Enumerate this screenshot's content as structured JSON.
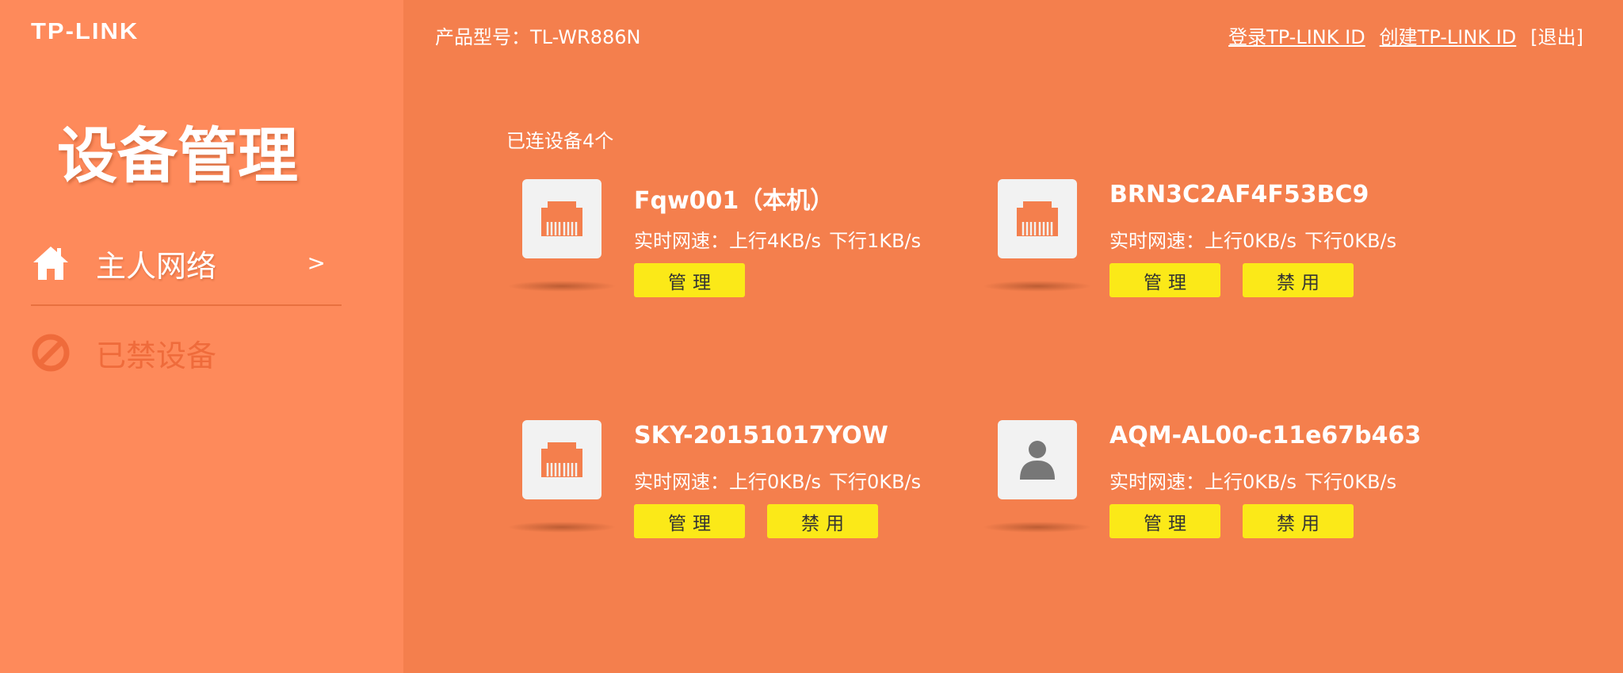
{
  "brand": {
    "logo_text": "TP-LINK"
  },
  "header": {
    "model": "产品型号：TL-WR886N",
    "login_link": "登录TP-LINK ID",
    "create_link": "创建TP-LINK ID",
    "logout_link": "[退出]"
  },
  "sidebar": {
    "title": "设备管理",
    "items": [
      {
        "label": "主人网络",
        "icon": "home-icon",
        "chevron": ">",
        "active": true
      },
      {
        "label": "已禁设备",
        "icon": "ban-icon",
        "active": false
      }
    ]
  },
  "main": {
    "connected_count": "已连设备4个",
    "devices": [
      {
        "name": "Fqw001（本机）",
        "speed_label": "实时网速：",
        "upload": "上行4KB/s",
        "download": "下行1KB/s",
        "icon": "ethernet-port-icon",
        "manage": "管理"
      },
      {
        "name": "BRN3C2AF4F53BC9",
        "speed_label": "实时网速：",
        "upload": "上行0KB/s",
        "download": "下行0KB/s",
        "icon": "ethernet-port-icon",
        "manage": "管理",
        "disable": "禁用"
      },
      {
        "name": "SKY-20151017YOW",
        "speed_label": "实时网速：",
        "upload": "上行0KB/s",
        "download": "下行0KB/s",
        "icon": "ethernet-port-icon",
        "manage": "管理",
        "disable": "禁用"
      },
      {
        "name": "AQM-AL00-c11e67b463",
        "speed_label": "实时网速：",
        "upload": "上行0KB/s",
        "download": "下行0KB/s",
        "icon": "person-icon",
        "manage": "管理",
        "disable": "禁用"
      }
    ]
  },
  "colors": {
    "main_bg": "#f47f4d",
    "sidebar_bg": "#fe8a5b",
    "button_bg": "#fbe918",
    "icon_accent": "#f47f4d",
    "disabled_text": "#ef6b3b"
  }
}
